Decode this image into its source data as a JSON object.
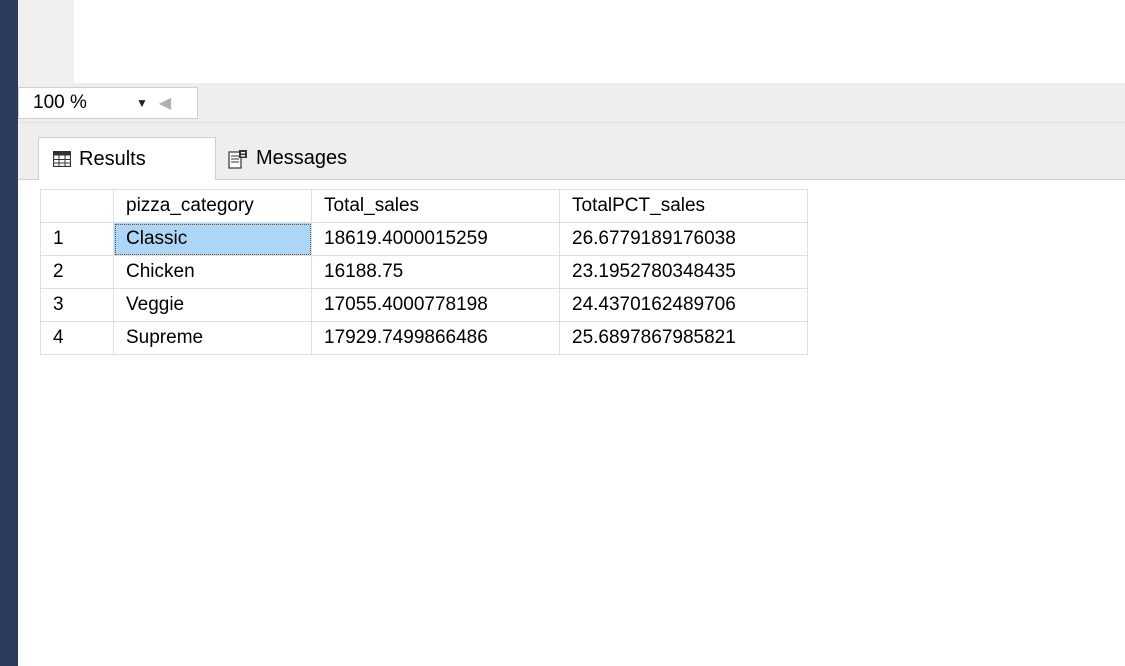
{
  "toolbar": {
    "zoom_value": "100 %"
  },
  "tabs": [
    {
      "label": "Results",
      "icon": "grid-icon",
      "active": true
    },
    {
      "label": "Messages",
      "icon": "messages-icon",
      "active": false
    }
  ],
  "results": {
    "columns": [
      "",
      "pizza_category",
      "Total_sales",
      "TotalPCT_sales"
    ],
    "rows": [
      [
        "1",
        "Classic",
        "18619.4000015259",
        "26.6779189176038"
      ],
      [
        "2",
        "Chicken",
        "16188.75",
        "23.1952780348435"
      ],
      [
        "3",
        "Veggie",
        "17055.4000778198",
        "24.4370162489706"
      ],
      [
        "4",
        "Supreme",
        "17929.7499866486",
        "25.6897867985821"
      ]
    ],
    "selected_cell": "Classic"
  },
  "colors": {
    "sidebar": "#2d3c5c",
    "selection": "#add5f5",
    "panel": "#eeeeee"
  }
}
